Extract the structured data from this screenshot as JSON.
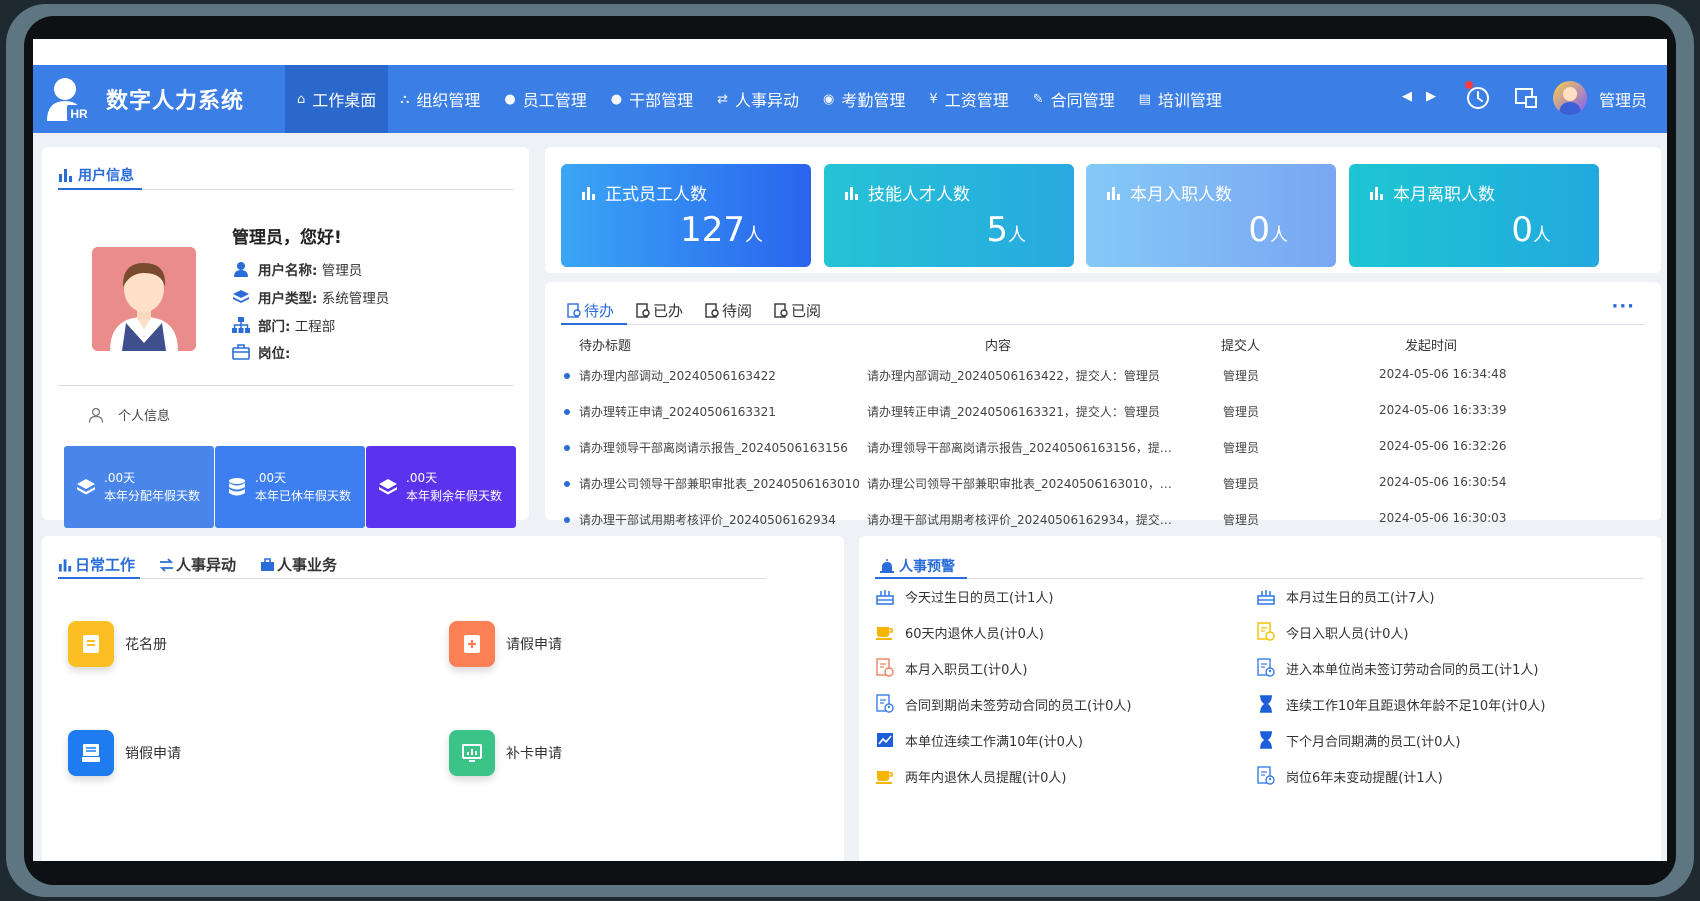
{
  "app": {
    "title": "数字人力系统",
    "logo_text": "HR"
  },
  "nav": [
    {
      "label": "工作桌面",
      "icon": "home-icon",
      "active": true
    },
    {
      "label": "组织管理",
      "icon": "org-icon"
    },
    {
      "label": "员工管理",
      "icon": "users-icon"
    },
    {
      "label": "干部管理",
      "icon": "person-icon"
    },
    {
      "label": "人事异动",
      "icon": "transfer-icon"
    },
    {
      "label": "考勤管理",
      "icon": "location-icon"
    },
    {
      "label": "工资管理",
      "icon": "yen-icon"
    },
    {
      "label": "合同管理",
      "icon": "contract-icon"
    },
    {
      "label": "培训管理",
      "icon": "training-icon"
    }
  ],
  "header": {
    "user_name": "管理员"
  },
  "user_panel": {
    "title": "用户信息",
    "greeting": "管理员，您好!",
    "fields": [
      {
        "key": "用户名称:",
        "value": "管理员",
        "icon": "user-icon"
      },
      {
        "key": "用户类型:",
        "value": "系统管理员",
        "icon": "layers-icon"
      },
      {
        "key": "部门:",
        "value": "工程部",
        "icon": "sitemap-icon"
      },
      {
        "key": "岗位:",
        "value": "",
        "icon": "briefcase-icon"
      }
    ],
    "personal_info": "个人信息",
    "leaves": [
      {
        "value": ".00天",
        "label": "本年分配年假天数",
        "color": "#4a86ea"
      },
      {
        "value": ".00天",
        "label": "本年已休年假天数",
        "color": "#3d7ef0"
      },
      {
        "value": ".00天",
        "label": "本年剩余年假天数",
        "color": "#5b33ee"
      }
    ]
  },
  "stats": [
    {
      "label": "正式员工人数",
      "value": "127",
      "unit": "人"
    },
    {
      "label": "技能人才人数",
      "value": "5",
      "unit": "人"
    },
    {
      "label": "本月入职人数",
      "value": "0",
      "unit": "人"
    },
    {
      "label": "本月离职人数",
      "value": "0",
      "unit": "人"
    }
  ],
  "tasks": {
    "tabs": [
      "待办",
      "已办",
      "待阅",
      "已阅"
    ],
    "more": "···",
    "columns": [
      "待办标题",
      "内容",
      "提交人",
      "发起时间"
    ],
    "rows": [
      {
        "title": "请办理内部调动_20240506163422",
        "content": "请办理内部调动_20240506163422，提交人：管理员",
        "submitter": "管理员",
        "time": "2024-05-06 16:34:48"
      },
      {
        "title": "请办理转正申请_20240506163321",
        "content": "请办理转正申请_20240506163321，提交人：管理员",
        "submitter": "管理员",
        "time": "2024-05-06 16:33:39"
      },
      {
        "title": "请办理领导干部离岗请示报告_20240506163156",
        "content": "请办理领导干部离岗请示报告_20240506163156，提…",
        "submitter": "管理员",
        "time": "2024-05-06 16:32:26"
      },
      {
        "title": "请办理公司领导干部兼职审批表_20240506163010",
        "content": "请办理公司领导干部兼职审批表_20240506163010，…",
        "submitter": "管理员",
        "time": "2024-05-06 16:30:54"
      },
      {
        "title": "请办理干部试用期考核评价_20240506162934",
        "content": "请办理干部试用期考核评价_20240506162934，提交…",
        "submitter": "管理员",
        "time": "2024-05-06 16:30:03"
      }
    ]
  },
  "daily": {
    "tabs": [
      "日常工作",
      "人事异动",
      "人事业务"
    ],
    "actions": [
      {
        "label": "花名册",
        "color": "#fbbf24",
        "icon": "roster-icon"
      },
      {
        "label": "请假申请",
        "color": "#fb8056",
        "icon": "leave-request-icon"
      },
      {
        "label": "销假申请",
        "color": "#1e7cf0",
        "icon": "cancel-leave-icon"
      },
      {
        "label": "补卡申请",
        "color": "#3cc488",
        "icon": "card-supplement-icon"
      }
    ]
  },
  "warnings": {
    "title": "人事预警",
    "items": [
      {
        "label": "今天过生日的员工(计1人)",
        "icon": "cake-icon",
        "color": "#3a7ee6"
      },
      {
        "label": "本月过生日的员工(计7人)",
        "icon": "cake-icon",
        "color": "#3a7ee6"
      },
      {
        "label": "60天内退休人员(计0人)",
        "icon": "coffee-icon",
        "color": "#f5b400"
      },
      {
        "label": "今日入职人员(计0人)",
        "icon": "doc-clock-icon",
        "color": "#f5c000"
      },
      {
        "label": "本月入职员工(计0人)",
        "icon": "doc-clock-icon",
        "color": "#f08060"
      },
      {
        "label": "进入本单位尚未签订劳动合同的员工(计1人)",
        "icon": "doc-person-icon",
        "color": "#3a7ee6"
      },
      {
        "label": "合同到期尚未签劳动合同的员工(计0人)",
        "icon": "doc-person-icon",
        "color": "#3a7ee6"
      },
      {
        "label": "连续工作10年且距退休年龄不足10年(计0人)",
        "icon": "hourglass-icon",
        "color": "#1d5fd8"
      },
      {
        "label": "本单位连续工作满10年(计0人)",
        "icon": "trend-icon",
        "color": "#1d5fd8"
      },
      {
        "label": "下个月合同期满的员工(计0人)",
        "icon": "hourglass-icon",
        "color": "#1d5fd8"
      },
      {
        "label": "两年内退休人员提醒(计0人)",
        "icon": "coffee-icon",
        "color": "#f5b400"
      },
      {
        "label": "岗位6年未变动提醒(计1人)",
        "icon": "doc-person-icon",
        "color": "#3a7ee6"
      }
    ]
  }
}
